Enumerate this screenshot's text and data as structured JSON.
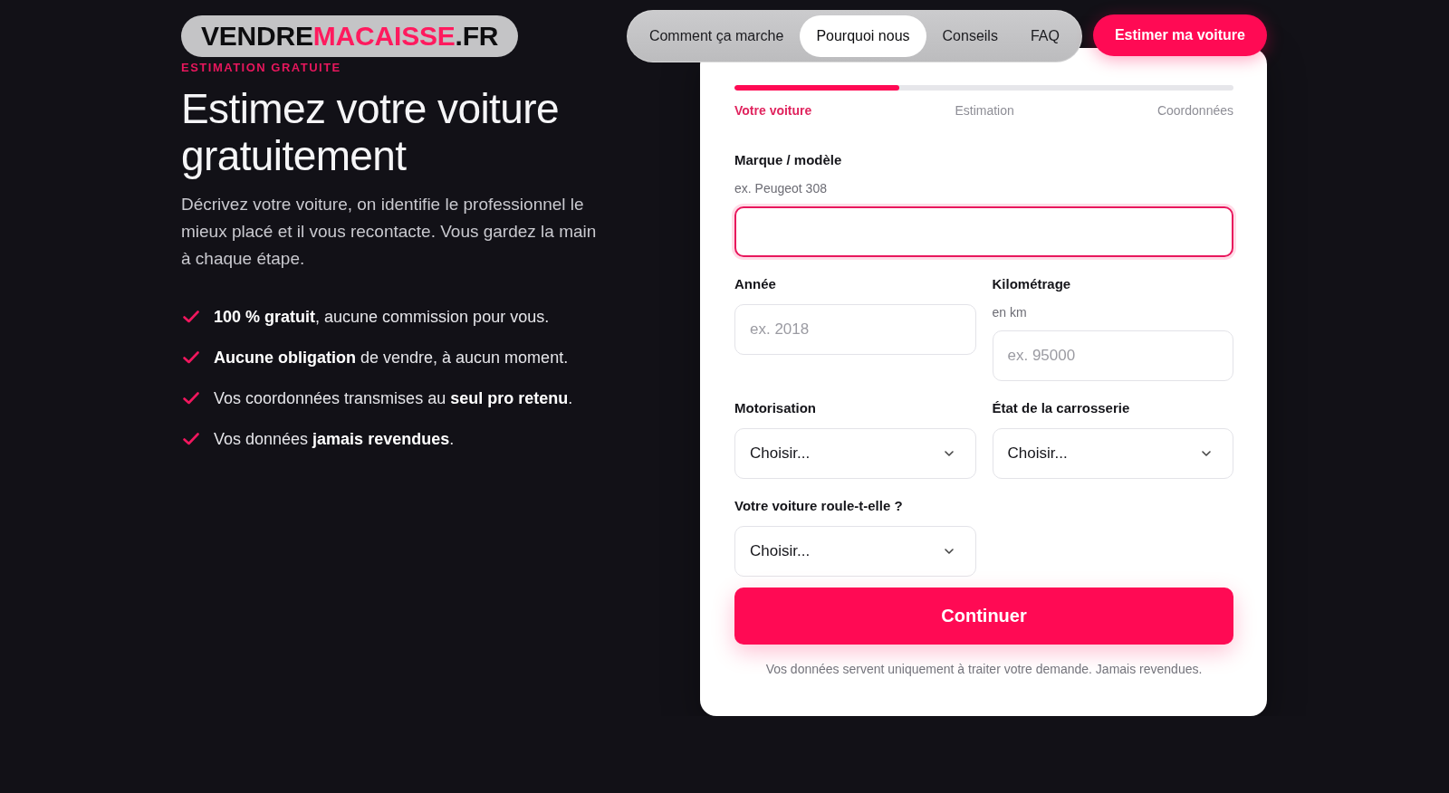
{
  "header": {
    "logo": [
      {
        "text": "VENDRE",
        "accent": false
      },
      {
        "text": "MACAISSE",
        "accent": true
      },
      {
        "text": ".FR",
        "accent": false
      }
    ],
    "nav": [
      {
        "label": "Comment ça marche",
        "selected": false
      },
      {
        "label": "Pourquoi nous",
        "selected": true
      },
      {
        "label": "Conseils",
        "selected": false
      },
      {
        "label": "FAQ",
        "selected": false
      }
    ],
    "cta": "Estimer ma voiture"
  },
  "hero": {
    "eyebrow": "ESTIMATION GRATUITE",
    "title": "Estimez votre voiture gratuitement",
    "description": "Décrivez votre voiture, on identifie le professionnel le mieux placé et il vous recontacte. Vous gardez la main à chaque étape.",
    "benefits": [
      "**100 % gratuit**, aucune commission pour vous.",
      "**Aucune obligation** de vendre, à aucun moment.",
      "Vos coordonnées transmises au **seul pro retenu**.",
      "Vos données **jamais revendues**."
    ]
  },
  "form": {
    "progress": {
      "level": 0.33
    },
    "steps": [
      {
        "label": "Votre voiture",
        "selected": true
      },
      {
        "label": "Estimation",
        "selected": false
      },
      {
        "label": "Coordonnées",
        "selected": false
      }
    ],
    "fields": [
      {
        "kind": "text",
        "label": "Marque / modèle",
        "hint": "ex. Peugeot 308",
        "wide": true,
        "focused": true
      },
      {
        "kind": "text",
        "label": "Année",
        "placeholder": "ex. 2018",
        "wide": false,
        "focused": false
      },
      {
        "kind": "text",
        "label": "Kilométrage",
        "hint": "en km",
        "placeholder": "ex. 95000",
        "wide": false,
        "focused": false
      },
      {
        "kind": "select",
        "label": "Motorisation",
        "value": "Choisir...",
        "wide": false,
        "focused": false
      },
      {
        "kind": "select",
        "label": "État de la carrosserie",
        "value": "Choisir...",
        "wide": false,
        "focused": false
      },
      {
        "kind": "select",
        "label": "Votre voiture roule-t-elle ?",
        "value": "Choisir...",
        "wide": false,
        "focused": false
      }
    ],
    "submit": "Continuer",
    "note": "Vos données servent uniquement à traiter votre demande. Jamais revendues."
  }
}
